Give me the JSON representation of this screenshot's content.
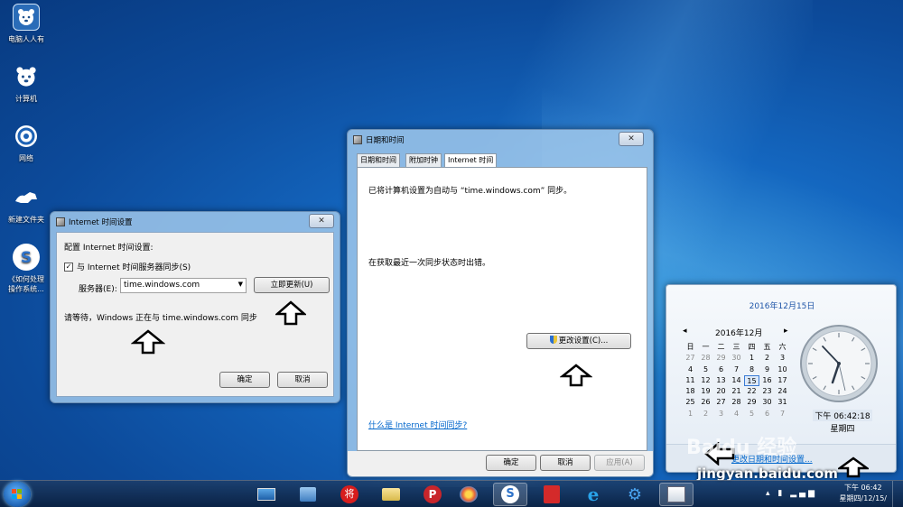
{
  "desktop": {
    "icons": [
      {
        "label": "电脑人人有",
        "icon": "bear-icon"
      },
      {
        "label": "计算机",
        "icon": "computer-icon"
      },
      {
        "label": "网络",
        "icon": "network-icon"
      },
      {
        "label": "新建文件夹",
        "icon": "folder-icon"
      },
      {
        "label": "《如何处理\n操作系统...",
        "icon": "sogou-icon"
      }
    ]
  },
  "internet_time_settings": {
    "title": "Internet 时间设置",
    "close": "✕",
    "heading": "配置 Internet 时间设置:",
    "sync_checkbox_label": "与 Internet 时间服务器同步(S)",
    "sync_checked": true,
    "server_label": "服务器(E):",
    "server_value": "time.windows.com",
    "update_now_button": "立即更新(U)",
    "status_text": "请等待，Windows 正在与 time.windows.com 同步",
    "ok_button": "确定",
    "cancel_button": "取消"
  },
  "date_time_dialog": {
    "title": "日期和时间",
    "close": "✕",
    "tabs": [
      "日期和时间",
      "附加时钟",
      "Internet 时间"
    ],
    "active_tab": 2,
    "sync_text": "已将计算机设置为自动与 “time.windows.com” 同步。",
    "error_text": "在获取最近一次同步状态时出错。",
    "change_settings_button": "更改设置(C)...",
    "help_link": "什么是 Internet 时间同步?",
    "ok_button": "确定",
    "cancel_button": "取消",
    "apply_button": "应用(A)"
  },
  "calendar_popup": {
    "date_header": "2016年12月15日",
    "month_label": "2016年12月",
    "prev": "◂",
    "next": "▸",
    "weekdays": [
      "日",
      "一",
      "二",
      "三",
      "四",
      "五",
      "六"
    ],
    "weeks": [
      [
        "27",
        "28",
        "29",
        "30",
        "1",
        "2",
        "3"
      ],
      [
        "4",
        "5",
        "6",
        "7",
        "8",
        "9",
        "10"
      ],
      [
        "11",
        "12",
        "13",
        "14",
        "15",
        "16",
        "17"
      ],
      [
        "18",
        "19",
        "20",
        "21",
        "22",
        "23",
        "24"
      ],
      [
        "25",
        "26",
        "27",
        "28",
        "29",
        "30",
        "31"
      ],
      [
        "1",
        "2",
        "3",
        "4",
        "5",
        "6",
        "7"
      ]
    ],
    "today": "15",
    "time_text": "下午 06:42:18",
    "weekday_text": "星期四",
    "change_link": "更改日期和时间设置..."
  },
  "taskbar": {
    "clock_time": "下午 06:42",
    "clock_date": "星期四/12/15/"
  },
  "watermark": {
    "brand": "Baidu 经验",
    "url": "jingyan.baidu.com"
  }
}
